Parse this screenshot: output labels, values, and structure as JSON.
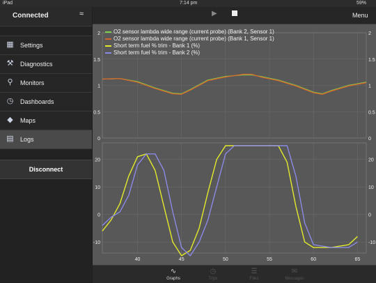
{
  "status": {
    "carrier": "iPad",
    "time": "7:14 pm",
    "battery": "59%"
  },
  "sidebar": {
    "connection": "Connected",
    "items": [
      {
        "label": "Settings",
        "icon": "settings-icon"
      },
      {
        "label": "Diagnostics",
        "icon": "wrench-icon"
      },
      {
        "label": "Monitors",
        "icon": "search-icon"
      },
      {
        "label": "Dashboards",
        "icon": "gauge-icon"
      },
      {
        "label": "Maps",
        "icon": "map-icon"
      },
      {
        "label": "Logs",
        "icon": "logs-icon"
      }
    ],
    "active": "Logs",
    "disconnect": "Disconnect"
  },
  "topbar": {
    "menu": "Menu"
  },
  "chart_data": {
    "type": "line",
    "x_ticks": [
      40,
      45,
      50,
      55,
      60,
      65
    ],
    "xlim": [
      36,
      66
    ],
    "legend": [
      {
        "label": "O2 sensor lambda wide range (current probe)  (Bank 2, Sensor 1)",
        "color": "#7fd14a"
      },
      {
        "label": "O2 sensor lambda wide range (current probe)  (Bank 1, Sensor 1)",
        "color": "#d2662c"
      },
      {
        "label": "Short term fuel % trim - Bank 1 (%)",
        "color": "#e4ea2c"
      },
      {
        "label": "Short term fuel % trim - Bank 2 (%)",
        "color": "#8a8ae6"
      }
    ],
    "upper": {
      "ylim": [
        0,
        2
      ],
      "y_ticks": [
        0,
        0.5,
        1,
        1.5,
        2
      ],
      "series": [
        {
          "name": "O2 sensor lambda wide range (current probe)  (Bank 2, Sensor 1)",
          "color": "#7fd14a",
          "points": [
            [
              36,
              1.12
            ],
            [
              38,
              1.13
            ],
            [
              40,
              1.07
            ],
            [
              42,
              0.95
            ],
            [
              44,
              0.85
            ],
            [
              45,
              0.84
            ],
            [
              46,
              0.92
            ],
            [
              48,
              1.1
            ],
            [
              50,
              1.17
            ],
            [
              52,
              1.2
            ],
            [
              53,
              1.2
            ],
            [
              54,
              1.17
            ],
            [
              56,
              1.1
            ],
            [
              58,
              1.0
            ],
            [
              60,
              0.87
            ],
            [
              61,
              0.84
            ],
            [
              62,
              0.9
            ],
            [
              64,
              1.0
            ],
            [
              66,
              1.06
            ]
          ]
        },
        {
          "name": "O2 sensor lambda wide range (current probe)  (Bank 1, Sensor 1)",
          "color": "#d2662c",
          "points": [
            [
              36,
              1.12
            ],
            [
              38,
              1.13
            ],
            [
              40,
              1.06
            ],
            [
              42,
              0.94
            ],
            [
              44,
              0.84
            ],
            [
              45,
              0.83
            ],
            [
              46,
              0.91
            ],
            [
              48,
              1.09
            ],
            [
              50,
              1.16
            ],
            [
              52,
              1.21
            ],
            [
              53,
              1.21
            ],
            [
              54,
              1.16
            ],
            [
              56,
              1.09
            ],
            [
              58,
              0.99
            ],
            [
              60,
              0.86
            ],
            [
              61,
              0.83
            ],
            [
              62,
              0.89
            ],
            [
              64,
              0.99
            ],
            [
              66,
              1.05
            ]
          ]
        }
      ]
    },
    "lower": {
      "ylim": [
        -14,
        26
      ],
      "y_ticks": [
        -10,
        0,
        10,
        20
      ],
      "series": [
        {
          "name": "Short term fuel % trim - Bank 1 (%)",
          "color": "#e4ea2c",
          "points": [
            [
              36,
              -6
            ],
            [
              37,
              -2
            ],
            [
              38,
              4
            ],
            [
              39,
              14
            ],
            [
              40,
              21
            ],
            [
              41,
              22
            ],
            [
              42,
              16
            ],
            [
              43,
              3
            ],
            [
              44,
              -10
            ],
            [
              45,
              -15
            ],
            [
              46,
              -13
            ],
            [
              47,
              -5
            ],
            [
              48,
              8
            ],
            [
              49,
              20
            ],
            [
              50,
              25
            ],
            [
              51,
              25
            ],
            [
              52,
              25
            ],
            [
              53,
              25
            ],
            [
              54,
              25
            ],
            [
              55,
              25
            ],
            [
              56,
              25
            ],
            [
              57,
              19
            ],
            [
              58,
              3
            ],
            [
              59,
              -10
            ],
            [
              60,
              -12
            ],
            [
              62,
              -12
            ],
            [
              64,
              -11
            ],
            [
              65,
              -8
            ]
          ]
        },
        {
          "name": "Short term fuel % trim - Bank 2 (%)",
          "color": "#8a8ae6",
          "points": [
            [
              36,
              -4
            ],
            [
              37,
              -1
            ],
            [
              38,
              1
            ],
            [
              39,
              7
            ],
            [
              40,
              18
            ],
            [
              41,
              22
            ],
            [
              42,
              22
            ],
            [
              43,
              16
            ],
            [
              44,
              1
            ],
            [
              45,
              -12
            ],
            [
              46,
              -15
            ],
            [
              47,
              -10
            ],
            [
              48,
              -2
            ],
            [
              49,
              10
            ],
            [
              50,
              22
            ],
            [
              51,
              25
            ],
            [
              52,
              25
            ],
            [
              53,
              25
            ],
            [
              54,
              25
            ],
            [
              55,
              25
            ],
            [
              56,
              25
            ],
            [
              57,
              25
            ],
            [
              58,
              14
            ],
            [
              59,
              -3
            ],
            [
              60,
              -11
            ],
            [
              62,
              -12
            ],
            [
              64,
              -12
            ],
            [
              65,
              -10
            ]
          ]
        }
      ]
    }
  },
  "tabs": [
    {
      "label": "Graphs",
      "icon": "graphs-icon",
      "active": true
    },
    {
      "label": "Trips",
      "icon": "trips-icon",
      "active": false
    },
    {
      "label": "Files",
      "icon": "files-icon",
      "active": false
    },
    {
      "label": "Messages",
      "icon": "messages-icon",
      "active": false
    }
  ]
}
